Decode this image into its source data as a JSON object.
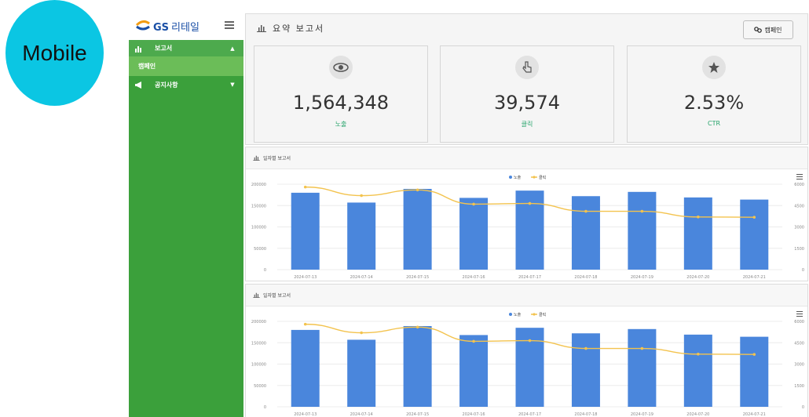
{
  "mobile_badge": "Mobile",
  "brand": {
    "logo_text": "GS",
    "logo_suffix": "리테일"
  },
  "sidebar": {
    "items": [
      {
        "label": "보고서"
      },
      {
        "label": "캠페인"
      },
      {
        "label": "공지사항"
      }
    ]
  },
  "summary": {
    "title": "요약 보고서",
    "campaign_button": "캠페인",
    "cards": [
      {
        "value": "1,564,348",
        "label": "노출",
        "icon": "eye-icon"
      },
      {
        "value": "39,574",
        "label": "클릭",
        "icon": "pointer-hand-icon"
      },
      {
        "value": "2.53%",
        "label": "CTR",
        "icon": "star-icon"
      }
    ]
  },
  "colors": {
    "sidebar": "#3ba03b",
    "bar": "#4a86dc",
    "line": "#f3c34e",
    "accent": "#27a46b"
  },
  "chart_data": [
    {
      "type": "bar",
      "title": "일자별 보고서",
      "categories": [
        "2024-07-13",
        "2024-07-14",
        "2024-07-15",
        "2024-07-16",
        "2024-07-17",
        "2024-07-18",
        "2024-07-19",
        "2024-07-20",
        "2024-07-21"
      ],
      "series": [
        {
          "name": "노출",
          "type": "bar",
          "axis": "left",
          "values": [
            180000,
            157000,
            189000,
            168000,
            185000,
            172000,
            182000,
            169000,
            164000
          ]
        },
        {
          "name": "클릭",
          "type": "line",
          "axis": "right",
          "values": [
            5800,
            5200,
            5600,
            4600,
            4650,
            4100,
            4100,
            3700,
            3680
          ]
        }
      ],
      "y_left": {
        "ticks": [
          "0",
          "50000",
          "100000",
          "150000",
          "200000"
        ],
        "range": [
          0,
          200000
        ]
      },
      "y_right": {
        "ticks": [
          "0",
          "1500",
          "3000",
          "4500",
          "6000"
        ],
        "range": [
          0,
          6000
        ]
      },
      "legend": "top-center"
    },
    {
      "type": "bar",
      "title": "일자별 보고서",
      "categories": [
        "2024-07-13",
        "2024-07-14",
        "2024-07-15",
        "2024-07-16",
        "2024-07-17",
        "2024-07-18",
        "2024-07-19",
        "2024-07-20",
        "2024-07-21"
      ],
      "series": [
        {
          "name": "노출",
          "type": "bar",
          "axis": "left",
          "values": [
            180000,
            157000,
            189000,
            168000,
            185000,
            172000,
            182000,
            169000,
            164000
          ]
        },
        {
          "name": "클릭",
          "type": "line",
          "axis": "right",
          "values": [
            5800,
            5200,
            5600,
            4600,
            4650,
            4100,
            4100,
            3700,
            3680
          ]
        }
      ],
      "y_left": {
        "ticks": [
          "0",
          "50000",
          "100000",
          "150000",
          "200000"
        ],
        "range": [
          0,
          200000
        ]
      },
      "y_right": {
        "ticks": [
          "0",
          "1500",
          "3000",
          "4500",
          "6000"
        ],
        "range": [
          0,
          6000
        ]
      },
      "legend": "top-center"
    }
  ]
}
